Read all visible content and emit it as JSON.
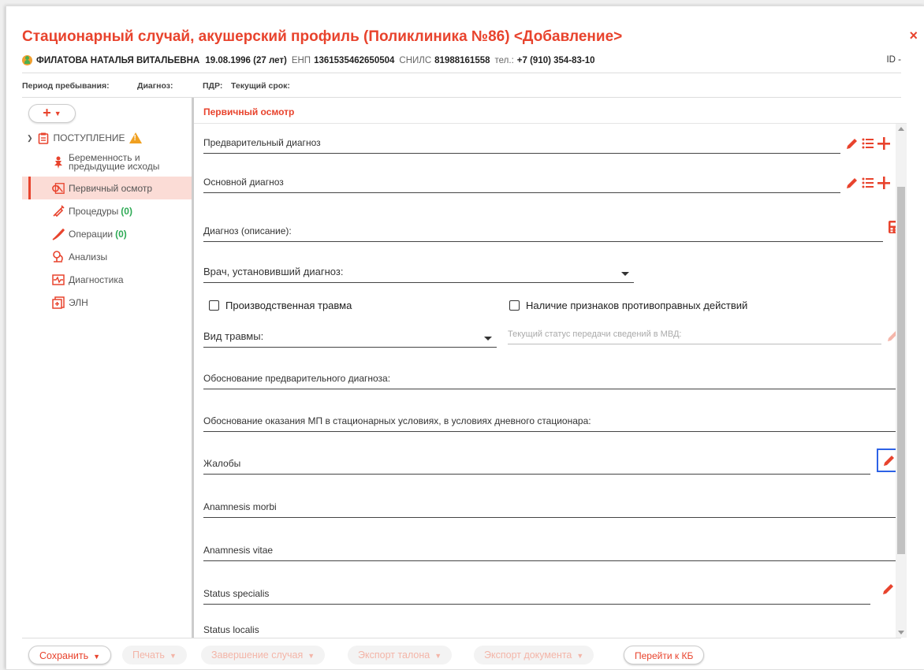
{
  "window": {
    "title": "Стационарный случай, акушерский профиль (Поликлиника №86) <Добавление>",
    "close_label": "×"
  },
  "patient": {
    "name": "ФИЛАТОВА НАТАЛЬЯ ВИТАЛЬЕВНА",
    "birth": "19.08.1996 (27 лет)",
    "enp_label": "ЕНП",
    "enp_value": "1361535462650504",
    "snils_label": "СНИЛС",
    "snils_value": "81988161558",
    "phone_label": "тел.:",
    "phone_value": "+7 (910) 354-83-10",
    "id_label": "ID -"
  },
  "meta": {
    "period": "Период пребывания:",
    "diagnosis": "Диагноз:",
    "pdr": "ПДР:",
    "term": "Текущий срок:"
  },
  "sidebar": {
    "add_label": "+",
    "root_label": "ПОСТУПЛЕНИЕ",
    "items": [
      {
        "label": "Беременность и предыдущие исходы",
        "icon": "pregnancy-icon"
      },
      {
        "label": "Первичный осмотр",
        "icon": "examination-icon",
        "active": true
      },
      {
        "label": "Процедуры",
        "count": "(0)",
        "icon": "syringe-icon"
      },
      {
        "label": "Операции",
        "count": "(0)",
        "icon": "scalpel-icon"
      },
      {
        "label": "Анализы",
        "icon": "microscope-icon"
      },
      {
        "label": "Диагностика",
        "icon": "cardiogram-icon"
      },
      {
        "label": "ЭЛН",
        "icon": "sick-leave-icon"
      }
    ]
  },
  "main": {
    "section_title": "Первичный осмотр",
    "fields": {
      "prelim_diag": "Предварительный диагноз",
      "main_diag": "Основной диагноз",
      "diag_desc": "Диагноз (описание):",
      "doctor": "Врач, установивший диагноз:",
      "industrial_injury": "Производственная травма",
      "illegal_actions": "Наличие признаков противоправных действий",
      "injury_type": "Вид травмы:",
      "mvd_status": "Текущий статус передачи сведений в МВД:",
      "prelim_justification": "Обоснование предварительного диагноза:",
      "hospital_justification": "Обоснование оказания МП в стационарных условиях, в условиях дневного стационара:",
      "complaints": "Жалобы",
      "anamnesis_morbi": "Anamnesis morbi",
      "anamnesis_vitae": "Anamnesis vitae",
      "status_specialis": "Status specialis",
      "status_localis": "Status localis"
    }
  },
  "footer": {
    "save": "Сохранить",
    "print": "Печать",
    "finish": "Завершение случая",
    "export_ticket": "Экспорт талона",
    "export_doc": "Экспорт документа",
    "goto_kb": "Перейти к КБ"
  },
  "colors": {
    "accent": "#e8432d",
    "active_bg": "#fbdcd6",
    "focus": "#2d62e6",
    "count": "#2eaa55",
    "warning": "#f0a020"
  }
}
